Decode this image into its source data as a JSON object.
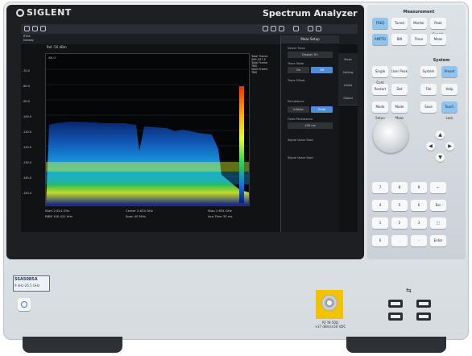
{
  "device": {
    "brand": "SIGLENT",
    "product": "Spectrum Analyzer",
    "model": "SSA5085A",
    "freq_range": "9 kHz-26.5 GHz",
    "rf_label": "RF IN 50Ω",
    "rf_spec": "+27 dBm/±50 VDC"
  },
  "screen": {
    "mode": "RTSA",
    "view": "Density",
    "ref_level": "Ref -50 dBm",
    "y_ticks": [
      "-60.0",
      "-70.0",
      "-80.0",
      "-90.0",
      "-100.0",
      "-110.0",
      "-120.0",
      "-130.0",
      "-140.0",
      "-150.0"
    ],
    "readouts": [
      "Total Traces",
      "585,357.5",
      "Total Frame",
      "TBD",
      "Valid Frame",
      "TBD"
    ],
    "footer": {
      "start": "Start 2.614 GHz",
      "rbw": "RBW 100.421 kHz",
      "center": "Center 2.634 GHz",
      "span": "Span 40 MHz",
      "stop": "Stop 2.654 GHz",
      "acq": "Acq Time 30 ms"
    },
    "menu": {
      "title": "Meas Setup",
      "items": [
        "Select Trace",
        "Display Tr1",
        "Trace State",
        "On",
        "Off",
        "Trace Offset",
        "Persistence",
        "Infinite",
        "Finite",
        "Finite Persistence",
        "100 ms",
        "Signal Value Start",
        "Signal Value Start"
      ]
    },
    "softtabs": [
      "Meas",
      "Setting",
      "Limits",
      "Global"
    ]
  },
  "keys": {
    "measurement_label": "Measurement",
    "system_label": "System",
    "row1": [
      "FREQ",
      "Tuned",
      "Marker",
      "Peak Search"
    ],
    "row2": [
      "AMPTD",
      "BW",
      "Trace",
      "Meas"
    ],
    "row3": [
      "Single Cont",
      "User Peak",
      "System",
      "Preset"
    ],
    "row4": [
      "Restart",
      "Det",
      "File",
      "Help"
    ],
    "row5": [
      "Mode Setup",
      "Mode Meas",
      "Save",
      "Touch Lock"
    ],
    "numpad": [
      "7",
      "8",
      "9",
      "←",
      "4",
      "5",
      "6",
      "Esc",
      "1",
      "2",
      "3",
      "□",
      "0",
      ".",
      "-",
      "Enter"
    ]
  }
}
